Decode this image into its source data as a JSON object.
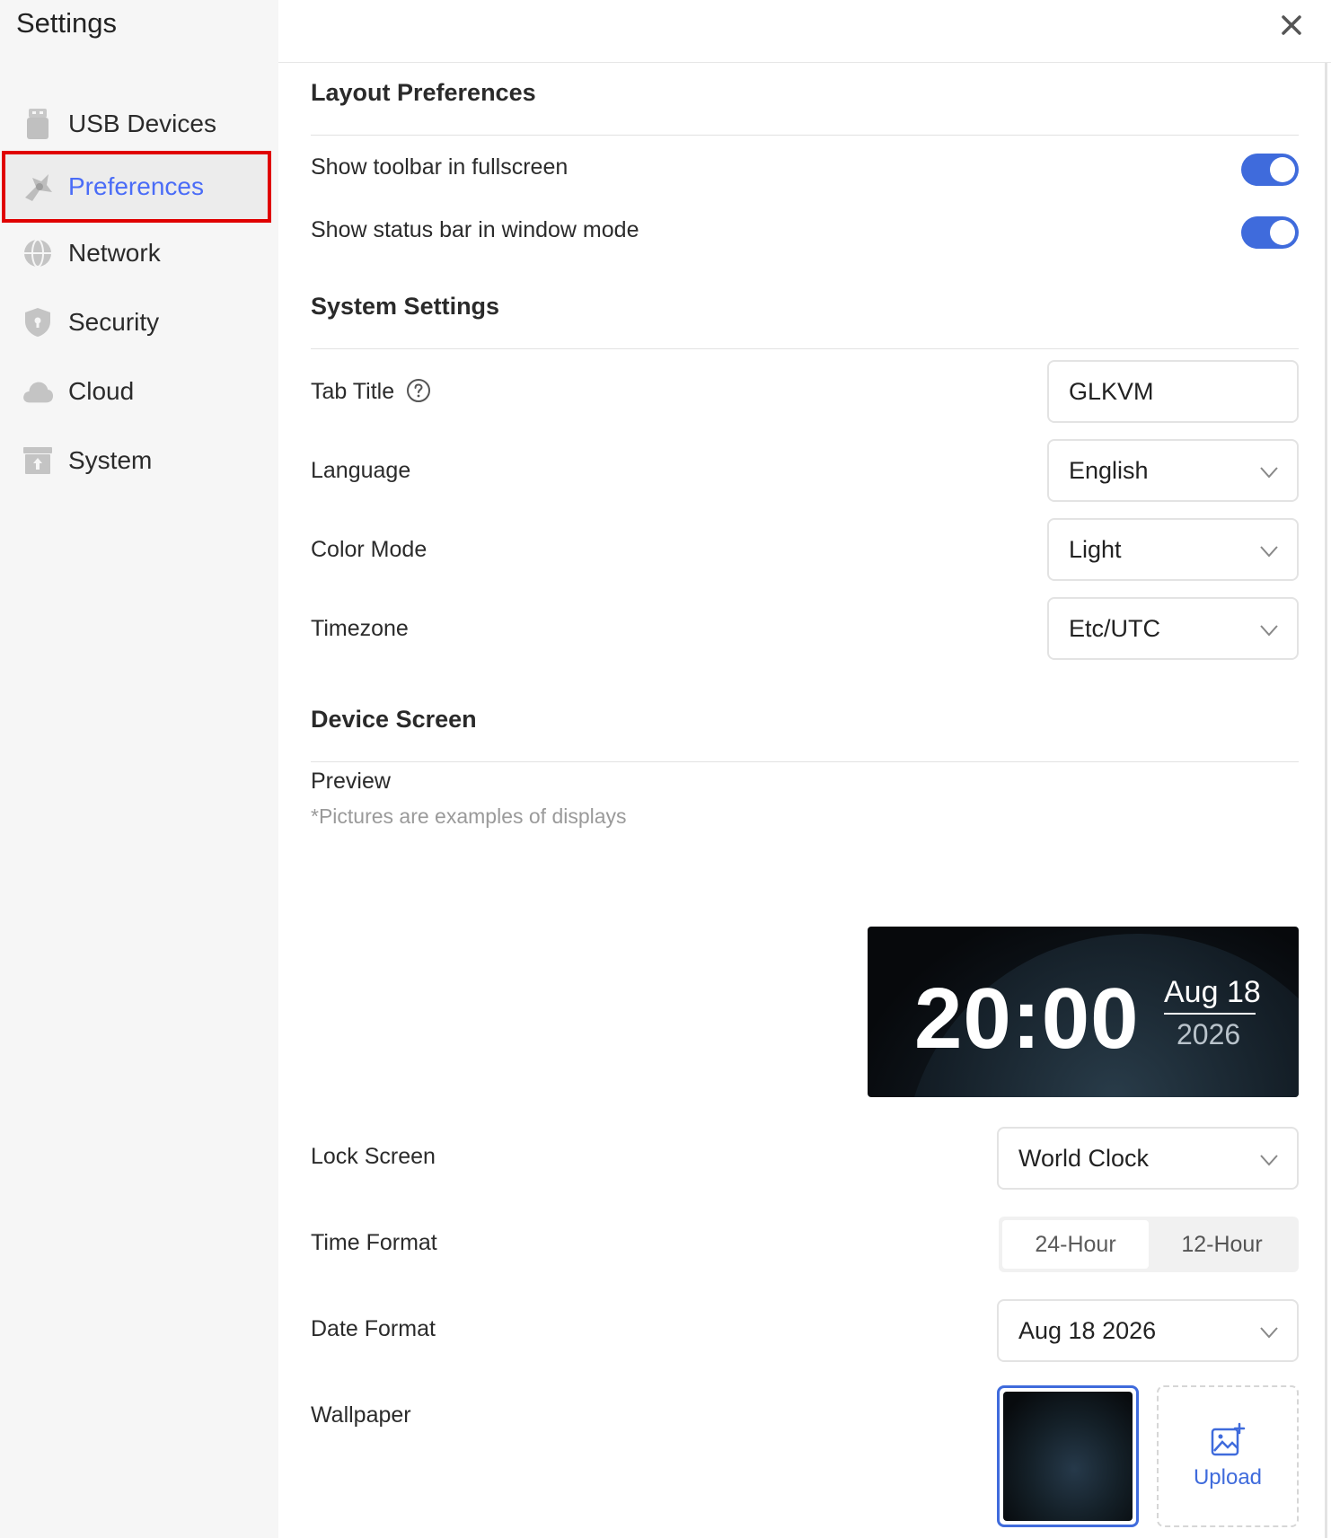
{
  "app": {
    "title": "Settings"
  },
  "sidebar": {
    "items": [
      {
        "label": "USB Devices",
        "icon": "usb-icon"
      },
      {
        "label": "Preferences",
        "icon": "preferences-icon",
        "active": true
      },
      {
        "label": "Network",
        "icon": "globe-icon"
      },
      {
        "label": "Security",
        "icon": "shield-icon"
      },
      {
        "label": "Cloud",
        "icon": "cloud-icon"
      },
      {
        "label": "System",
        "icon": "system-icon"
      }
    ]
  },
  "layout_preferences": {
    "title": "Layout Preferences",
    "toolbar_fullscreen": {
      "label": "Show toolbar in fullscreen",
      "on": true
    },
    "status_bar_window": {
      "label": "Show status bar in window mode",
      "on": true
    }
  },
  "system_settings": {
    "title": "System Settings",
    "tab_title": {
      "label": "Tab Title",
      "value": "GLKVM"
    },
    "language": {
      "label": "Language",
      "value": "English"
    },
    "color_mode": {
      "label": "Color Mode",
      "value": "Light"
    },
    "timezone": {
      "label": "Timezone",
      "value": "Etc/UTC"
    }
  },
  "device_screen": {
    "title": "Device Screen",
    "preview_label": "Preview",
    "preview_hint": "*Pictures are examples of displays",
    "preview": {
      "time": "20:00",
      "date": "Aug 18",
      "year": "2026"
    },
    "lock_screen": {
      "label": "Lock Screen",
      "value": "World Clock"
    },
    "time_format": {
      "label": "Time Format",
      "options": [
        "24-Hour",
        "12-Hour"
      ],
      "selected": "24-Hour"
    },
    "date_format": {
      "label": "Date Format",
      "value": "Aug 18 2026"
    },
    "wallpaper": {
      "label": "Wallpaper",
      "upload_label": "Upload"
    }
  },
  "colors": {
    "accent": "#3f6bdc",
    "active_nav_text": "#4a6cf7",
    "highlight_box": "#e00000"
  }
}
